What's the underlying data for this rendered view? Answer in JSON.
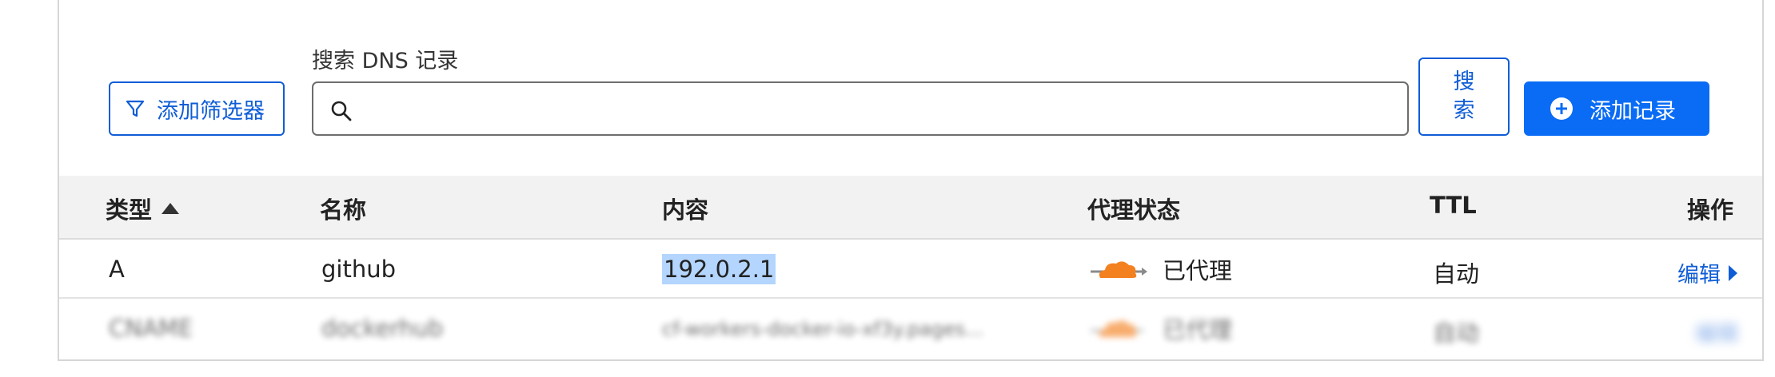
{
  "search": {
    "label": "搜索 DNS 记录",
    "placeholder": "",
    "value": ""
  },
  "toolbar": {
    "filter_label": "添加筛选器",
    "search_button_label": "搜索",
    "add_record_label": "添加记录"
  },
  "table": {
    "headers": {
      "type": "类型",
      "name": "名称",
      "content": "内容",
      "proxy_status": "代理状态",
      "ttl": "TTL",
      "actions": "操作"
    },
    "rows": [
      {
        "type": "A",
        "name": "github",
        "content": "192.0.2.1",
        "proxy_status": "已代理",
        "ttl": "自动",
        "action": "编辑"
      },
      {
        "type": "CNAME",
        "name": "dockerhub",
        "content": "cf-workers-docker-io-xf3y.pages...",
        "proxy_status": "已代理",
        "ttl": "自动",
        "action": "编辑"
      }
    ]
  },
  "colors": {
    "accent": "#0f5dd6",
    "primary_button": "#0a6cf5",
    "proxy_cloud": "#f48120",
    "selection_highlight": "#b4d5fe"
  }
}
